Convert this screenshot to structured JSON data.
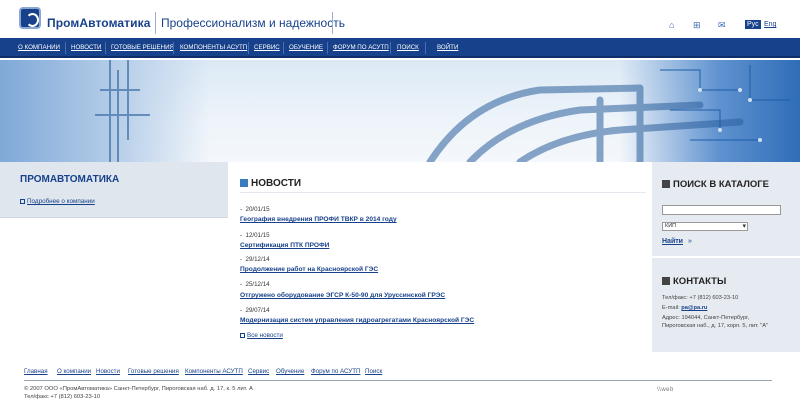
{
  "header": {
    "logo_text": "ПромАвтоматика",
    "tagline": "Профессионализм и надежность",
    "icons": [
      "home-icon",
      "sitemap-icon",
      "mail-icon"
    ],
    "lang_ru": "Рус",
    "lang_en": "Eng"
  },
  "nav": {
    "items": [
      "О КОМПАНИИ",
      "НОВОСТИ",
      "ГОТОВЫЕ РЕШЕНИЯ",
      "КОМПОНЕНТЫ АСУТП",
      "СЕРВИС",
      "ОБУЧЕНИЕ",
      "ФОРУМ ПО АСУТП",
      "ПОИСК",
      "ВОЙТИ"
    ]
  },
  "left": {
    "title": "ПРОМАВТОМАТИКА",
    "link": "Подробнее о компании"
  },
  "news": {
    "title": "НОВОСТИ",
    "items": [
      {
        "date": "20/01/15",
        "title": "География внедрения ПРОФИ ТВКР в 2014 году"
      },
      {
        "date": "12/01/15",
        "title": "Сертификация ПТК ПРОФИ"
      },
      {
        "date": "29/12/14",
        "title": "Продолжение работ на Красноярской ГЭС"
      },
      {
        "date": "25/12/14",
        "title": "Отгружено оборудование ЭГСР К-50-90 для Уруссинской ГРЭС"
      },
      {
        "date": "29/07/14",
        "title": "Модернизация систем управления гидроагрегатами Красноярской ГЭС"
      }
    ],
    "all_link": "Все новости"
  },
  "catalog": {
    "title": "ПОИСК В КАТАЛОГЕ",
    "search_value": "",
    "select_value": "КИП",
    "find_label": "Найти",
    "find_arrow": "»"
  },
  "contacts": {
    "title": "КОНТАКТЫ",
    "phone": "Тел/факс: +7 (812) 603-23-10",
    "email_label": "E-mail: ",
    "email": "pa@pa.ru",
    "address1": "Адрес: 194044, Санкт-Петербург,",
    "address2": "Пироговская наб., д. 17, корп. 5, лит. \"А\""
  },
  "footer": {
    "links": [
      "Главная",
      "О компании",
      "Новости",
      "Готовые решения",
      "Компоненты АСУТП",
      "Сервис",
      "Обучение",
      "Форум по АСУТП",
      "Поиск"
    ],
    "copyright": "© 2007 ООО «ПромАвтоматика» Санкт-Петербург, Пироговская наб. д. 17, к. 5 лит. А",
    "phone": "Тел/факс +7 (812) 603-23-10",
    "brand": "\\\\web"
  },
  "colors": {
    "brand": "#17418a",
    "nav_bg": "#17418a",
    "panel_bg": "#e6ebf1"
  }
}
